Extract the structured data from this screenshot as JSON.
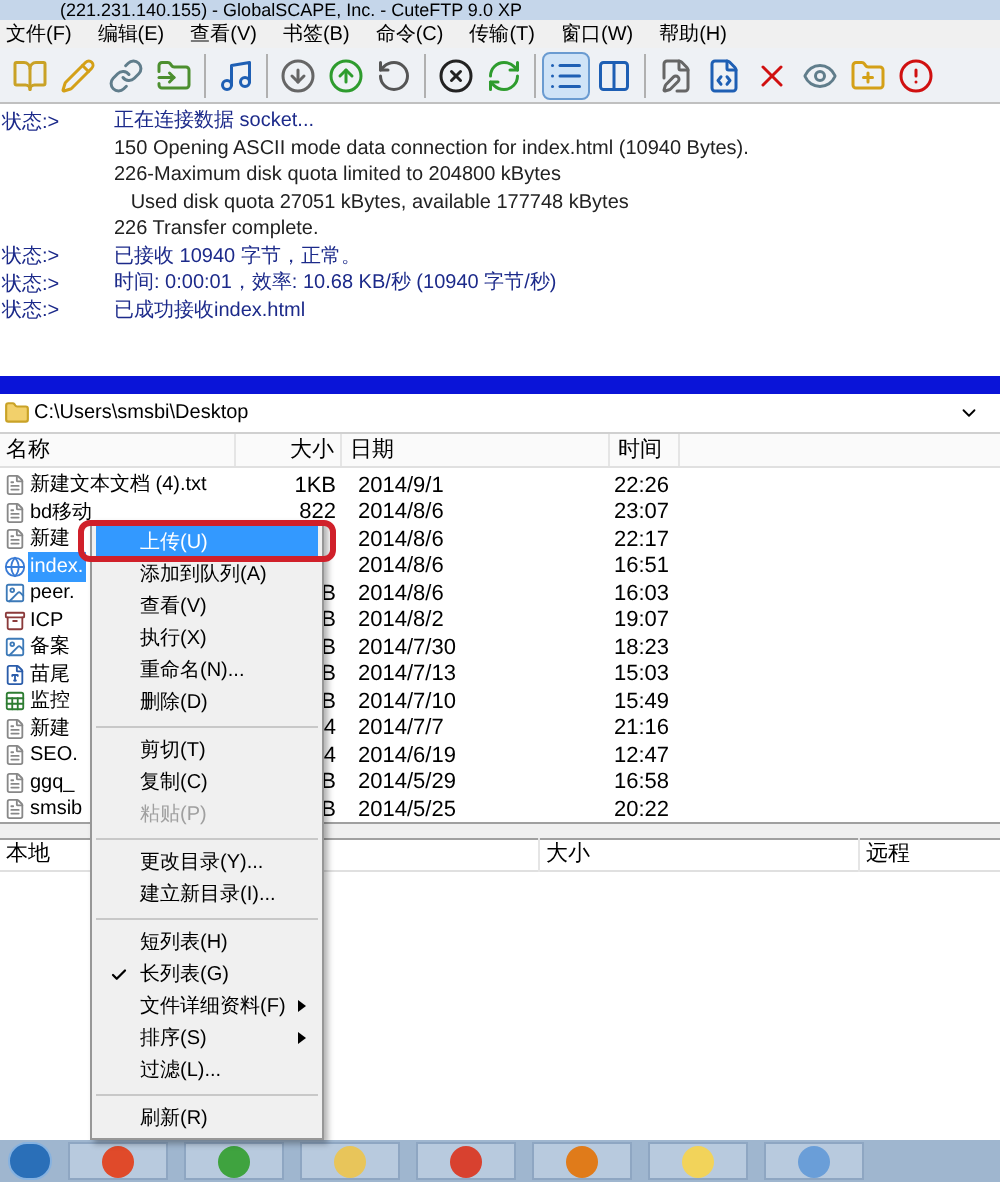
{
  "window": {
    "title": "(221.231.140.155) - GlobalSCAPE, Inc. - CuteFTP 9.0 XP"
  },
  "menu_bar": [
    "文件(F)",
    "编辑(E)",
    "查看(V)",
    "书签(B)",
    "命令(C)",
    "传输(T)",
    "窗口(W)",
    "帮助(H)"
  ],
  "view_buttons": [
    {
      "selected": true
    },
    {
      "selected": false
    }
  ],
  "log": [
    {
      "kind": "status",
      "label": "状态:>",
      "text": "正在连接数据 socket..."
    },
    {
      "kind": "response",
      "text": "150 Opening ASCII mode data connection for index.html (10940 Bytes)."
    },
    {
      "kind": "response",
      "text": "226-Maximum disk quota limited to 204800 kBytes"
    },
    {
      "kind": "response",
      "text": "   Used disk quota 27051 kBytes, available 177748 kBytes"
    },
    {
      "kind": "response",
      "text": "226 Transfer complete."
    },
    {
      "kind": "status",
      "label": "状态:>",
      "text": "已接收 10940 字节，正常。"
    },
    {
      "kind": "status",
      "label": "状态:>",
      "text": "时间: 0:00:01，效率: 10.68 KB/秒 (10940 字节/秒)"
    },
    {
      "kind": "status",
      "label": "状态:>",
      "text": "已成功接收index.html"
    }
  ],
  "address": "C:\\Users\\smsbi\\Desktop",
  "file_list": {
    "columns": [
      "名称",
      "大小",
      "日期",
      "时间"
    ],
    "rows": [
      {
        "kind": "text",
        "name": "新建文本文档 (4).txt",
        "size": "1KB",
        "date": "2014/9/1",
        "time": "22:26",
        "selected": false
      },
      {
        "kind": "text",
        "name": "bd移动",
        "size": "822",
        "date": "2014/8/6",
        "time": "23:07",
        "selected": false
      },
      {
        "kind": "text",
        "name": "新建",
        "size": "",
        "date": "2014/8/6",
        "time": "22:17",
        "selected": false
      },
      {
        "kind": "html",
        "name": "index.",
        "size": "",
        "date": "2014/8/6",
        "time": "16:51",
        "selected": true
      },
      {
        "kind": "image",
        "name": "peer.",
        "size": "B",
        "date": "2014/8/6",
        "time": "16:03",
        "selected": false
      },
      {
        "kind": "archive",
        "name": "ICP",
        "size": "B",
        "date": "2014/8/2",
        "time": "19:07",
        "selected": false
      },
      {
        "kind": "image",
        "name": "备案",
        "size": "B",
        "date": "2014/7/30",
        "time": "18:23",
        "selected": false
      },
      {
        "kind": "word",
        "name": "苗尾",
        "size": "B",
        "date": "2014/7/13",
        "time": "15:03",
        "selected": false
      },
      {
        "kind": "excel",
        "name": "监控",
        "size": "B",
        "date": "2014/7/10",
        "time": "15:49",
        "selected": false
      },
      {
        "kind": "text",
        "name": "新建",
        "size": "4",
        "date": "2014/7/7",
        "time": "21:16",
        "selected": false
      },
      {
        "kind": "text",
        "name": "SEO.",
        "size": "4",
        "date": "2014/6/19",
        "time": "12:47",
        "selected": false
      },
      {
        "kind": "text",
        "name": "ggq_",
        "size": "B",
        "date": "2014/5/29",
        "time": "16:58",
        "selected": false
      },
      {
        "kind": "text",
        "name": "smsib",
        "size": "B",
        "date": "2014/5/25",
        "time": "20:22",
        "selected": false
      }
    ]
  },
  "queue": {
    "columns": [
      "本地",
      "大小",
      "远程"
    ]
  },
  "context_menu": [
    {
      "kind": "item",
      "label": "上传(U)",
      "selected": true,
      "disabled": false,
      "checked": false,
      "submenu": false
    },
    {
      "kind": "item",
      "label": "添加到队列(A)",
      "selected": false,
      "disabled": false,
      "checked": false,
      "submenu": false
    },
    {
      "kind": "item",
      "label": "查看(V)",
      "selected": false,
      "disabled": false,
      "checked": false,
      "submenu": false
    },
    {
      "kind": "item",
      "label": "执行(X)",
      "selected": false,
      "disabled": false,
      "checked": false,
      "submenu": false
    },
    {
      "kind": "item",
      "label": "重命名(N)...",
      "selected": false,
      "disabled": false,
      "checked": false,
      "submenu": false
    },
    {
      "kind": "item",
      "label": "删除(D)",
      "selected": false,
      "disabled": false,
      "checked": false,
      "submenu": false
    },
    {
      "kind": "separator"
    },
    {
      "kind": "item",
      "label": "剪切(T)",
      "selected": false,
      "disabled": false,
      "checked": false,
      "submenu": false
    },
    {
      "kind": "item",
      "label": "复制(C)",
      "selected": false,
      "disabled": false,
      "checked": false,
      "submenu": false
    },
    {
      "kind": "item",
      "label": "粘贴(P)",
      "selected": false,
      "disabled": true,
      "checked": false,
      "submenu": false
    },
    {
      "kind": "separator"
    },
    {
      "kind": "item",
      "label": "更改目录(Y)...",
      "selected": false,
      "disabled": false,
      "checked": false,
      "submenu": false
    },
    {
      "kind": "item",
      "label": "建立新目录(I)...",
      "selected": false,
      "disabled": false,
      "checked": false,
      "submenu": false
    },
    {
      "kind": "separator"
    },
    {
      "kind": "item",
      "label": "短列表(H)",
      "selected": false,
      "disabled": false,
      "checked": false,
      "submenu": false
    },
    {
      "kind": "item",
      "label": "长列表(G)",
      "selected": false,
      "disabled": false,
      "checked": true,
      "submenu": false
    },
    {
      "kind": "item",
      "label": "文件详细资料(F)",
      "selected": false,
      "disabled": false,
      "checked": false,
      "submenu": true
    },
    {
      "kind": "item",
      "label": "排序(S)",
      "selected": false,
      "disabled": false,
      "checked": false,
      "submenu": true
    },
    {
      "kind": "item",
      "label": "过滤(L)...",
      "selected": false,
      "disabled": false,
      "checked": false,
      "submenu": false
    },
    {
      "kind": "separator"
    },
    {
      "kind": "item",
      "label": "刷新(R)",
      "selected": false,
      "disabled": false,
      "checked": false,
      "submenu": false
    }
  ]
}
